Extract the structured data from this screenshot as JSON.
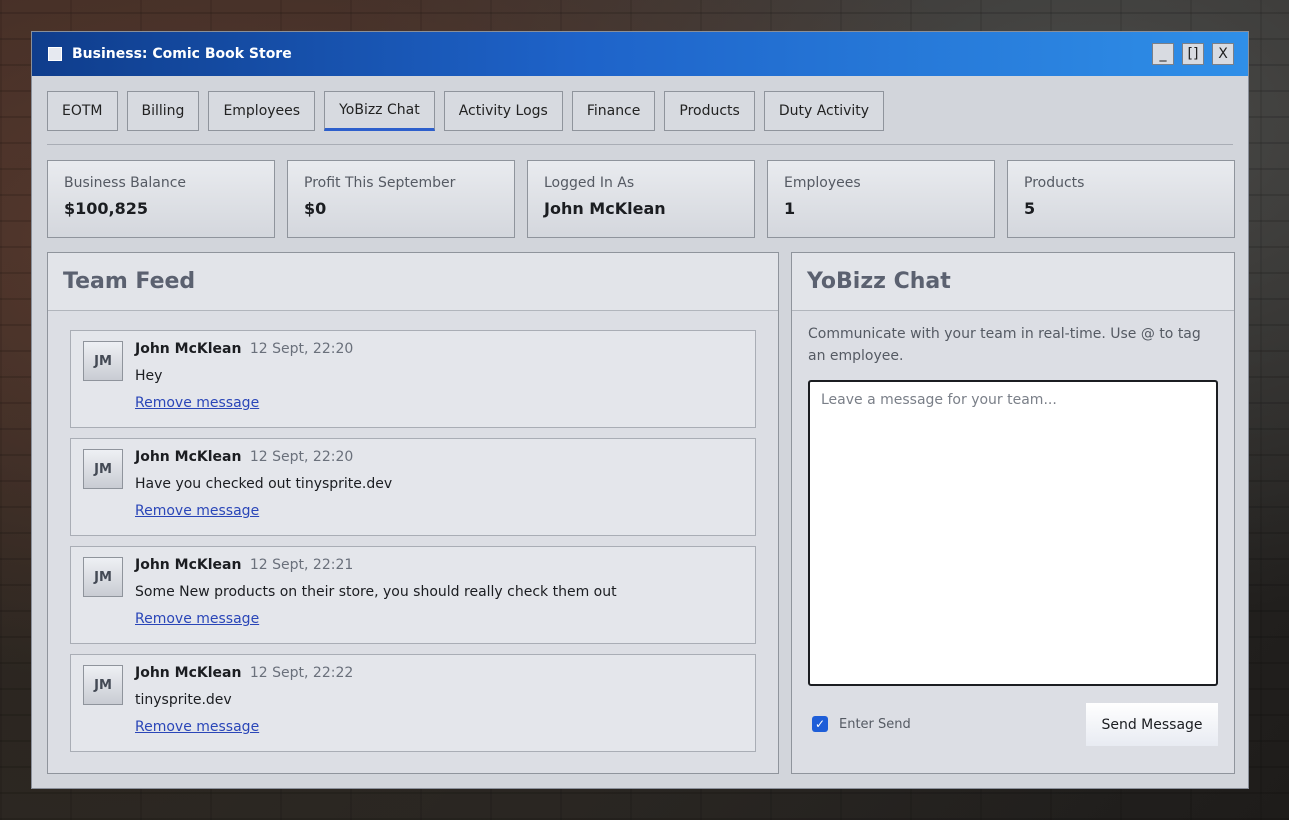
{
  "window": {
    "title": "Business: Comic Book Store",
    "controls": {
      "minimize": "_",
      "maximize": "[]",
      "close": "X"
    }
  },
  "tabs": [
    {
      "label": "EOTM",
      "active": false
    },
    {
      "label": "Billing",
      "active": false
    },
    {
      "label": "Employees",
      "active": false
    },
    {
      "label": "YoBizz Chat",
      "active": true
    },
    {
      "label": "Activity Logs",
      "active": false
    },
    {
      "label": "Finance",
      "active": false
    },
    {
      "label": "Products",
      "active": false
    },
    {
      "label": "Duty Activity",
      "active": false
    }
  ],
  "stats": [
    {
      "label": "Business Balance",
      "value": "$100,825"
    },
    {
      "label": "Profit This September",
      "value": "$0"
    },
    {
      "label": "Logged In As",
      "value": "John McKlean"
    },
    {
      "label": "Employees",
      "value": "1"
    },
    {
      "label": "Products",
      "value": "5"
    }
  ],
  "feed": {
    "title": "Team Feed",
    "messages": [
      {
        "initials": "JM",
        "author": "John McKlean",
        "time": "12 Sept, 22:20",
        "text": "Hey",
        "remove_label": "Remove message"
      },
      {
        "initials": "JM",
        "author": "John McKlean",
        "time": "12 Sept, 22:20",
        "text": "Have you checked out tinysprite.dev",
        "remove_label": "Remove message"
      },
      {
        "initials": "JM",
        "author": "John McKlean",
        "time": "12 Sept, 22:21",
        "text": "Some New products on their store, you should really check them out",
        "remove_label": "Remove message"
      },
      {
        "initials": "JM",
        "author": "John McKlean",
        "time": "12 Sept, 22:22",
        "text": "tinysprite.dev",
        "remove_label": "Remove message"
      }
    ]
  },
  "chat": {
    "title": "YoBizz Chat",
    "description": "Communicate with your team in real-time. Use @ to tag an employee.",
    "input_placeholder": "Leave a message for your team...",
    "input_value": "",
    "enter_send_label": "Enter Send",
    "enter_send_checked": true,
    "send_label": "Send Message"
  },
  "colors": {
    "titlebar_start": "#0f3d8c",
    "titlebar_end": "#2f8fe8",
    "active_tab_underline": "#2d5fcc",
    "link": "#2a46b8",
    "checkbox": "#1e5ed8"
  }
}
